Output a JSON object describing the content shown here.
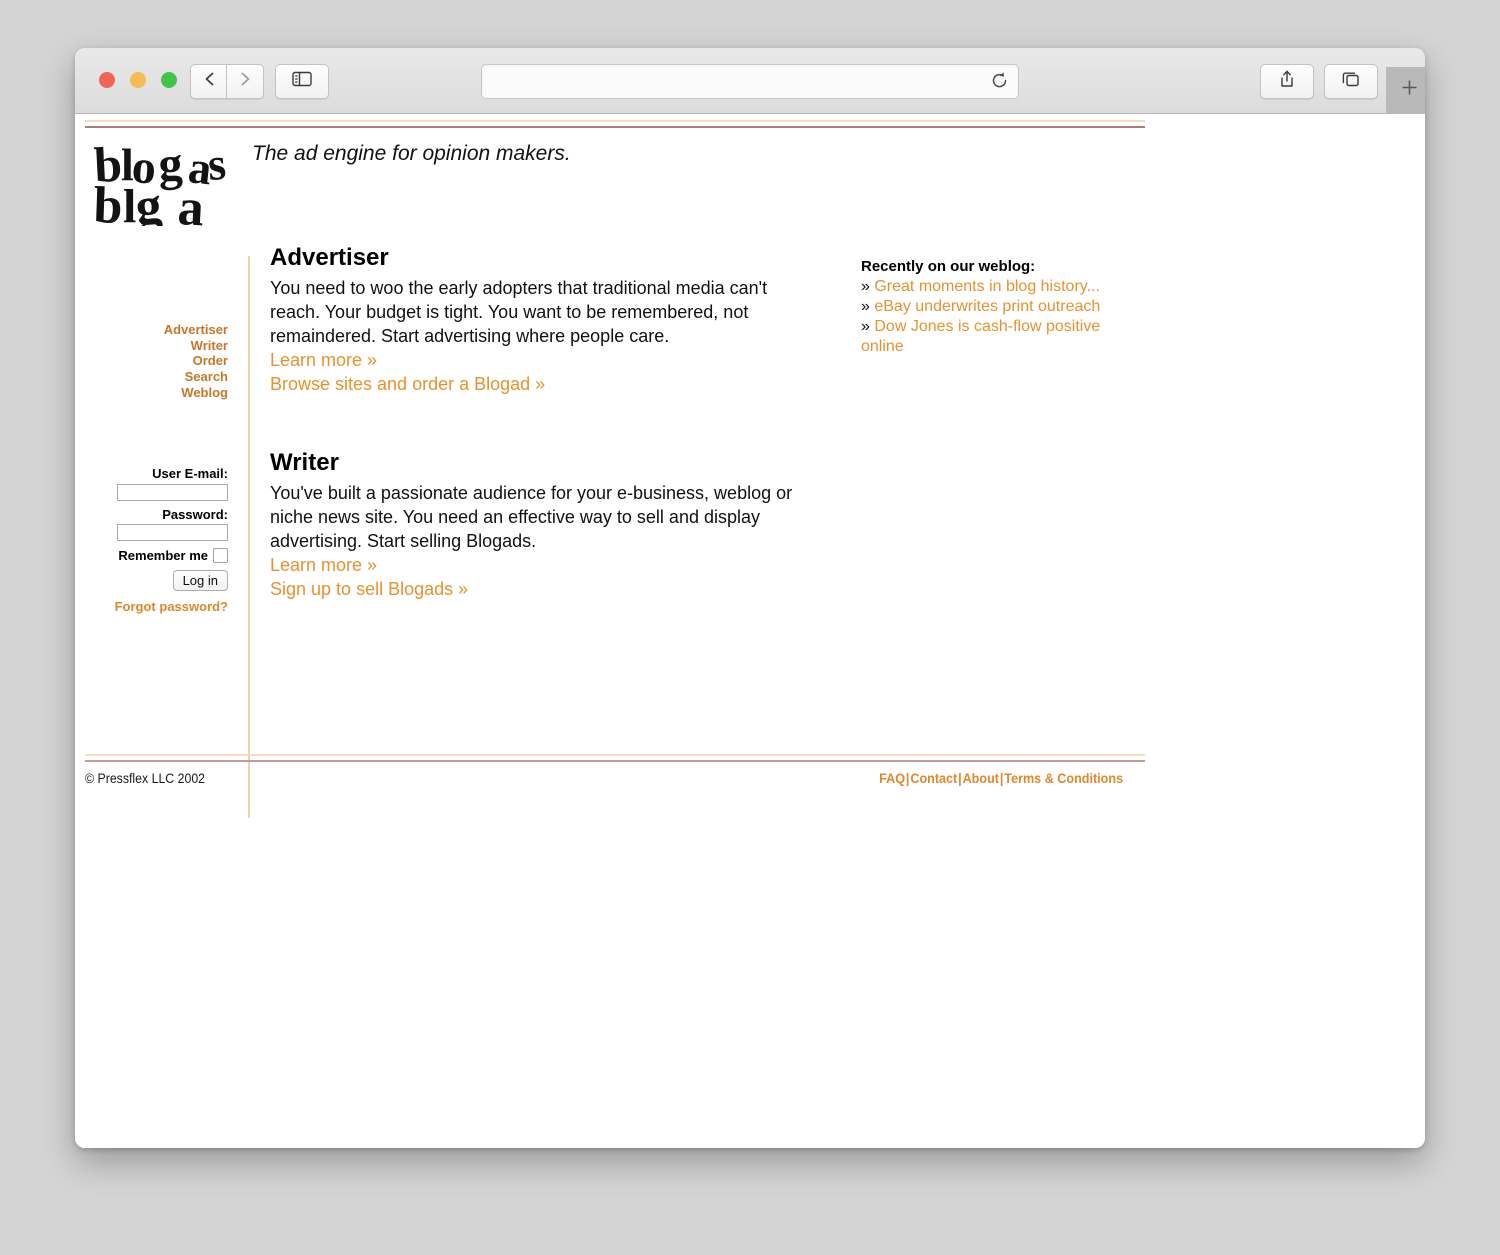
{
  "browser": {
    "window_controls": [
      "close",
      "minimize",
      "maximize"
    ],
    "back_icon": "chevron-left-icon",
    "forward_icon": "chevron-right-icon",
    "sidebar_icon": "sidebar-toggle-icon",
    "address_value": "",
    "address_placeholder": "",
    "reload_icon": "reload-icon",
    "share_icon": "share-icon",
    "tabs_icon": "show-tabs-icon",
    "newtab_icon": "plus-icon"
  },
  "site": {
    "logo_text": "blogads",
    "tagline": "The ad engine for opinion makers."
  },
  "nav": {
    "items": [
      {
        "label": "Advertiser"
      },
      {
        "label": "Writer"
      },
      {
        "label": "Order"
      },
      {
        "label": "Search"
      },
      {
        "label": "Weblog"
      }
    ]
  },
  "login": {
    "email_label": "User E-mail:",
    "email_value": "",
    "email_placeholder": "",
    "password_label": "Password:",
    "password_value": "",
    "password_placeholder": "",
    "remember_label": "Remember me",
    "remember_checked": false,
    "submit_label": "Log in",
    "forgot_label": "Forgot password?"
  },
  "main": {
    "sections": [
      {
        "title": "Advertiser",
        "body": "You need to woo the early adopters that traditional media can't reach. Your budget is tight. You want to be remembered, not remaindered. Start advertising where people care.",
        "link1": "Learn more »",
        "link2": "Browse sites and order a Blogad »"
      },
      {
        "title": "Writer",
        "body": "You've built a passionate audience for your e-business, weblog or niche news site. You need an effective way to sell and display advertising. Start selling Blogads.",
        "link1": "Learn more »",
        "link2": "Sign up to sell Blogads »"
      }
    ]
  },
  "weblog": {
    "title": "Recently on our weblog:",
    "bullet": "»",
    "items": [
      {
        "label": "Great moments in blog history..."
      },
      {
        "label": "eBay underwrites print outreach"
      },
      {
        "label": "Dow Jones is cash-flow positive online"
      }
    ]
  },
  "footer": {
    "copyright": "© Pressflex LLC 2002",
    "separator": "|",
    "links": [
      {
        "label": "FAQ"
      },
      {
        "label": "Contact"
      },
      {
        "label": "About"
      },
      {
        "label": "Terms & Conditions"
      }
    ]
  },
  "colors": {
    "link_orange": "#e8922e",
    "nav_orange": "#c8762a",
    "rule_cream": "#f2dfc0",
    "rule_maroon": "#9b4a4a",
    "divider_tan": "#e8d3ac"
  }
}
